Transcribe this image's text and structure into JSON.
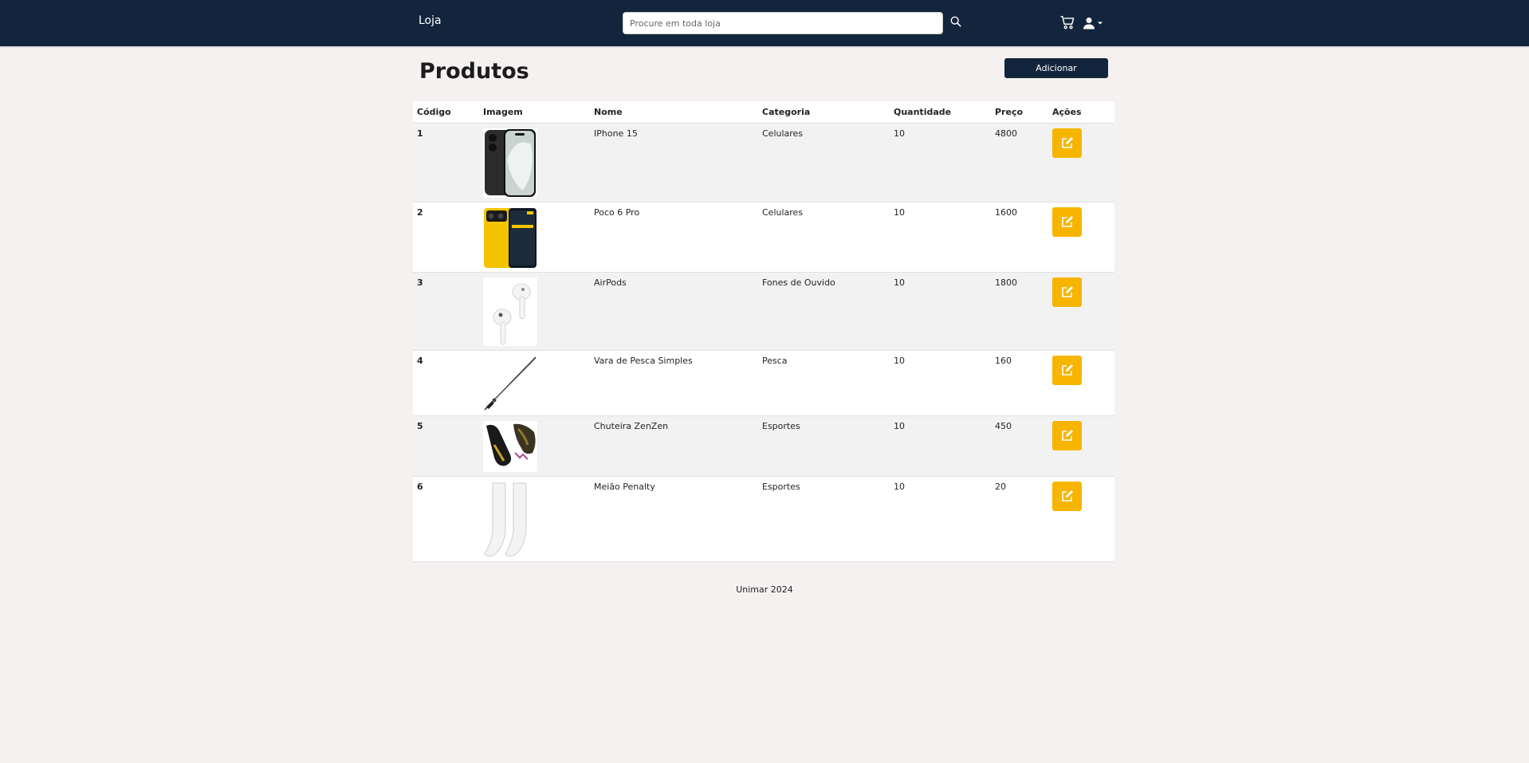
{
  "navbar": {
    "brand": "Loja",
    "search_placeholder": "Procure em toda loja"
  },
  "page": {
    "title": "Produtos",
    "add_button": "Adicionar"
  },
  "table": {
    "headers": [
      "Código",
      "Imagem",
      "Nome",
      "Categoria",
      "Quantidade",
      "Preço",
      "Ações"
    ],
    "rows": [
      {
        "code": "1",
        "name": "IPhone 15",
        "category": "Celulares",
        "quantity": "10",
        "price": "4800",
        "image": "iphone-15-image"
      },
      {
        "code": "2",
        "name": "Poco 6 Pro",
        "category": "Celulares",
        "quantity": "10",
        "price": "1600",
        "image": "poco-6-pro-image"
      },
      {
        "code": "3",
        "name": "AirPods",
        "category": "Fones de Ouvido",
        "quantity": "10",
        "price": "1800",
        "image": "airpods-image"
      },
      {
        "code": "4",
        "name": "Vara de Pesca Simples",
        "category": "Pesca",
        "quantity": "10",
        "price": "160",
        "image": "fishing-rod-image"
      },
      {
        "code": "5",
        "name": "Chuteira ZenZen",
        "category": "Esportes",
        "quantity": "10",
        "price": "450",
        "image": "soccer-cleats-image"
      },
      {
        "code": "6",
        "name": "Meião Penalty",
        "category": "Esportes",
        "quantity": "10",
        "price": "20",
        "image": "soccer-socks-image"
      }
    ]
  },
  "footer": {
    "text": "Unimar 2024"
  },
  "colors": {
    "navbar": "#13253d",
    "edit_button": "#f7b500",
    "background": "#f5f1f1"
  }
}
